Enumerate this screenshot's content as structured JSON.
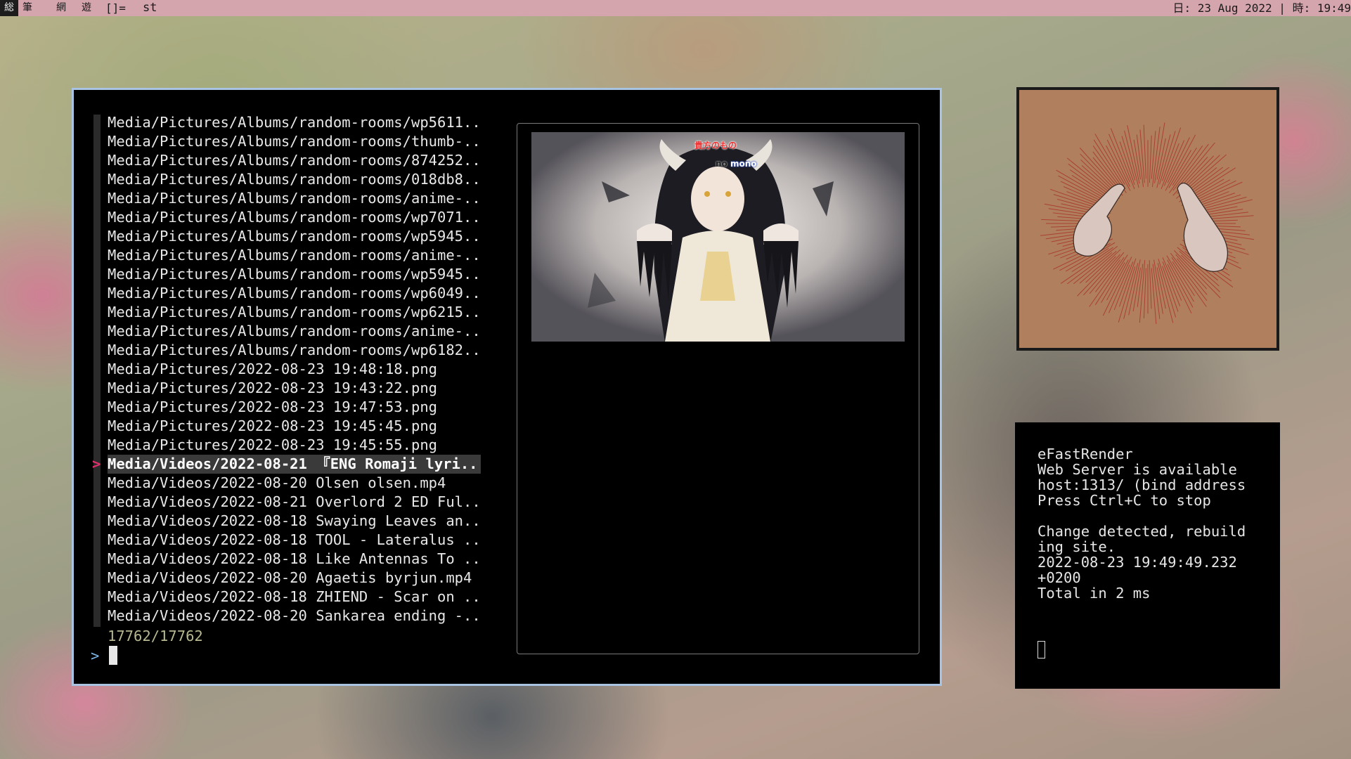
{
  "topbar": {
    "tags": [
      "総",
      "筆",
      "網",
      "遊"
    ],
    "layout_symbol": "[]=",
    "window_title": "st",
    "status": "日: 23 Aug 2022 | 時: 19:49"
  },
  "fzf": {
    "items": [
      "Media/Pictures/Albums/random-rooms/wp5611..",
      "Media/Pictures/Albums/random-rooms/thumb-..",
      "Media/Pictures/Albums/random-rooms/874252..",
      "Media/Pictures/Albums/random-rooms/018db8..",
      "Media/Pictures/Albums/random-rooms/anime-..",
      "Media/Pictures/Albums/random-rooms/wp7071..",
      "Media/Pictures/Albums/random-rooms/wp5945..",
      "Media/Pictures/Albums/random-rooms/anime-..",
      "Media/Pictures/Albums/random-rooms/wp5945..",
      "Media/Pictures/Albums/random-rooms/wp6049..",
      "Media/Pictures/Albums/random-rooms/wp6215..",
      "Media/Pictures/Albums/random-rooms/anime-..",
      "Media/Pictures/Albums/random-rooms/wp6182..",
      "Media/Pictures/2022-08-23 19:48:18.png",
      "Media/Pictures/2022-08-23 19:43:22.png",
      "Media/Pictures/2022-08-23 19:47:53.png",
      "Media/Pictures/2022-08-23 19:45:45.png",
      "Media/Pictures/2022-08-23 19:45:55.png",
      "Media/Videos/2022-08-21 『ENG Romaji lyri..",
      "Media/Videos/2022-08-20 Olsen olsen.mp4",
      "Media/Videos/2022-08-21 Overlord 2 ED Ful..",
      "Media/Videos/2022-08-18 Swaying Leaves an..",
      "Media/Videos/2022-08-18 TOOL - Lateralus ..",
      "Media/Videos/2022-08-18 Like Antennas To ..",
      "Media/Videos/2022-08-20 Agaetis byrjun.mp4",
      "Media/Videos/2022-08-18 ZHIEND - Scar on ..",
      "Media/Videos/2022-08-20 Sankarea ending -.."
    ],
    "selected_index": 18,
    "pointer": ">",
    "count": "17762/17762",
    "prompt": ">",
    "query": ""
  },
  "preview": {
    "subtitle_line1": "貴方のもの",
    "subtitle_line2_a": "no",
    "subtitle_line2_b": "mono"
  },
  "server": {
    "lines": [
      "eFastRender",
      "Web Server is available",
      "host:1313/ (bind address",
      "Press Ctrl+C to stop",
      "",
      "Change detected, rebuild",
      "ing site.",
      "2022-08-23 19:49:49.232",
      "+0200",
      "Total in 2 ms"
    ]
  },
  "colors": {
    "topbar_bg": "#d5a5ad",
    "focused_border": "#a9c3e3",
    "pointer": "#e0306a",
    "count": "#b7b88f",
    "prompt": "#7fb7e6"
  }
}
